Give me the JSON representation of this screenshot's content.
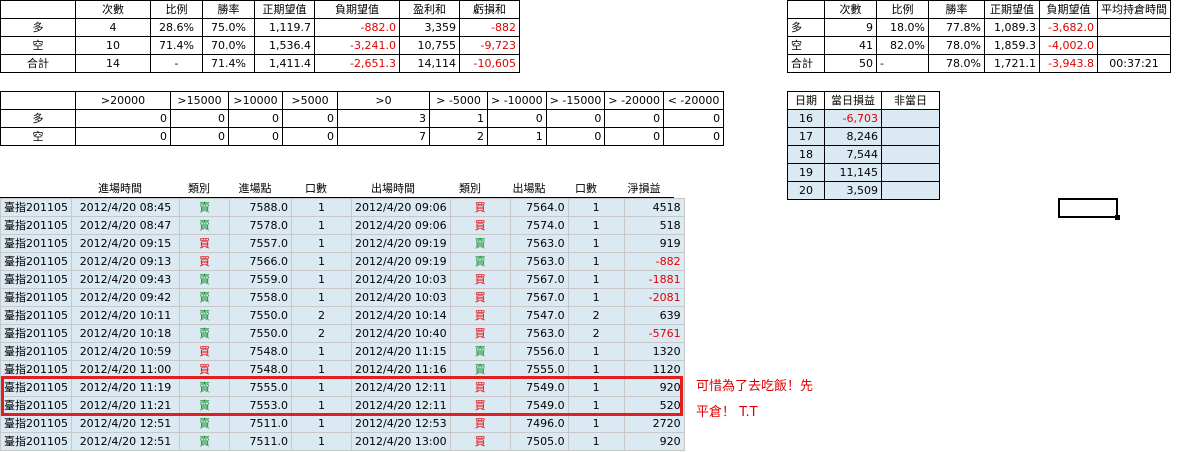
{
  "summary_left": {
    "headers": [
      "",
      "次數",
      "比例",
      "勝率",
      "正期望值",
      "負期望值",
      "盈利和",
      "虧損和"
    ],
    "rows": [
      {
        "label": "多",
        "count": "4",
        "ratio": "28.6%",
        "winrate": "75.0%",
        "pos_ev": "1,119.7",
        "neg_ev": "-882.0",
        "profit": "3,359",
        "loss": "-882"
      },
      {
        "label": "空",
        "count": "10",
        "ratio": "71.4%",
        "winrate": "70.0%",
        "pos_ev": "1,536.4",
        "neg_ev": "-3,241.0",
        "profit": "10,755",
        "loss": "-9,723"
      },
      {
        "label": "合計",
        "count": "14",
        "ratio": "-",
        "winrate": "71.4%",
        "pos_ev": "1,411.4",
        "neg_ev": "-2,651.3",
        "profit": "14,114",
        "loss": "-10,605"
      }
    ]
  },
  "summary_right": {
    "headers": [
      "",
      "次數",
      "比例",
      "勝率",
      "正期望值",
      "負期望值",
      "平均持倉時間"
    ],
    "rows": [
      {
        "label": "多",
        "count": "9",
        "ratio": "18.0%",
        "winrate": "77.8%",
        "pos_ev": "1,089.3",
        "neg_ev": "-3,682.0",
        "avg_time": ""
      },
      {
        "label": "空",
        "count": "41",
        "ratio": "82.0%",
        "winrate": "78.0%",
        "pos_ev": "1,859.3",
        "neg_ev": "-4,002.0",
        "avg_time": ""
      },
      {
        "label": "合計",
        "count": "50",
        "ratio": "-",
        "winrate": "78.0%",
        "pos_ev": "1,721.1",
        "neg_ev": "-3,943.8",
        "avg_time": "00:37:21"
      }
    ]
  },
  "distribution": {
    "headers": [
      ">20000",
      ">15000",
      ">10000",
      ">5000",
      ">0",
      "> -5000",
      "> -10000",
      "> -15000",
      "> -20000",
      "< -20000"
    ],
    "rows": [
      {
        "label": "多",
        "values": [
          "0",
          "0",
          "0",
          "0",
          "3",
          "1",
          "0",
          "0",
          "0",
          "0"
        ]
      },
      {
        "label": "空",
        "values": [
          "0",
          "0",
          "0",
          "0",
          "7",
          "2",
          "1",
          "0",
          "0",
          "0"
        ]
      }
    ]
  },
  "daily": {
    "headers": [
      "日期",
      "當日損益",
      "非當日"
    ],
    "rows": [
      {
        "day": "16",
        "pnl": "-6,703",
        "other": ""
      },
      {
        "day": "17",
        "pnl": "8,246",
        "other": ""
      },
      {
        "day": "18",
        "pnl": "7,544",
        "other": ""
      },
      {
        "day": "19",
        "pnl": "11,145",
        "other": ""
      },
      {
        "day": "20",
        "pnl": "3,509",
        "other": ""
      }
    ]
  },
  "trades": {
    "headers": [
      "",
      "進場時間",
      "類別",
      "進場點",
      "口數",
      "出場時間",
      "類別",
      "出場點",
      "口數",
      "淨損益"
    ],
    "rows": [
      {
        "symbol": "臺指201105",
        "entry_time": "2012/4/20 08:45",
        "entry_type": "賣",
        "entry_price": "7588.0",
        "entry_qty": "1",
        "exit_time": "2012/4/20 09:06",
        "exit_type": "買",
        "exit_price": "7564.0",
        "exit_qty": "1",
        "pnl": "4518"
      },
      {
        "symbol": "臺指201105",
        "entry_time": "2012/4/20 08:47",
        "entry_type": "賣",
        "entry_price": "7578.0",
        "entry_qty": "1",
        "exit_time": "2012/4/20 09:06",
        "exit_type": "買",
        "exit_price": "7574.0",
        "exit_qty": "1",
        "pnl": "518"
      },
      {
        "symbol": "臺指201105",
        "entry_time": "2012/4/20 09:15",
        "entry_type": "買",
        "entry_price": "7557.0",
        "entry_qty": "1",
        "exit_time": "2012/4/20 09:19",
        "exit_type": "賣",
        "exit_price": "7563.0",
        "exit_qty": "1",
        "pnl": "919"
      },
      {
        "symbol": "臺指201105",
        "entry_time": "2012/4/20 09:13",
        "entry_type": "買",
        "entry_price": "7566.0",
        "entry_qty": "1",
        "exit_time": "2012/4/20 09:19",
        "exit_type": "賣",
        "exit_price": "7563.0",
        "exit_qty": "1",
        "pnl": "-882"
      },
      {
        "symbol": "臺指201105",
        "entry_time": "2012/4/20 09:43",
        "entry_type": "賣",
        "entry_price": "7559.0",
        "entry_qty": "1",
        "exit_time": "2012/4/20 10:03",
        "exit_type": "買",
        "exit_price": "7567.0",
        "exit_qty": "1",
        "pnl": "-1881"
      },
      {
        "symbol": "臺指201105",
        "entry_time": "2012/4/20 09:42",
        "entry_type": "賣",
        "entry_price": "7558.0",
        "entry_qty": "1",
        "exit_time": "2012/4/20 10:03",
        "exit_type": "買",
        "exit_price": "7567.0",
        "exit_qty": "1",
        "pnl": "-2081"
      },
      {
        "symbol": "臺指201105",
        "entry_time": "2012/4/20 10:11",
        "entry_type": "賣",
        "entry_price": "7550.0",
        "entry_qty": "2",
        "exit_time": "2012/4/20 10:14",
        "exit_type": "買",
        "exit_price": "7547.0",
        "exit_qty": "2",
        "pnl": "639"
      },
      {
        "symbol": "臺指201105",
        "entry_time": "2012/4/20 10:18",
        "entry_type": "賣",
        "entry_price": "7550.0",
        "entry_qty": "2",
        "exit_time": "2012/4/20 10:40",
        "exit_type": "買",
        "exit_price": "7563.0",
        "exit_qty": "2",
        "pnl": "-5761"
      },
      {
        "symbol": "臺指201105",
        "entry_time": "2012/4/20 10:59",
        "entry_type": "買",
        "entry_price": "7548.0",
        "entry_qty": "1",
        "exit_time": "2012/4/20 11:15",
        "exit_type": "賣",
        "exit_price": "7556.0",
        "exit_qty": "1",
        "pnl": "1320"
      },
      {
        "symbol": "臺指201105",
        "entry_time": "2012/4/20 11:00",
        "entry_type": "買",
        "entry_price": "7548.0",
        "entry_qty": "1",
        "exit_time": "2012/4/20 11:16",
        "exit_type": "賣",
        "exit_price": "7555.0",
        "exit_qty": "1",
        "pnl": "1120"
      },
      {
        "symbol": "臺指201105",
        "entry_time": "2012/4/20 11:19",
        "entry_type": "賣",
        "entry_price": "7555.0",
        "entry_qty": "1",
        "exit_time": "2012/4/20 12:11",
        "exit_type": "買",
        "exit_price": "7549.0",
        "exit_qty": "1",
        "pnl": "920"
      },
      {
        "symbol": "臺指201105",
        "entry_time": "2012/4/20 11:21",
        "entry_type": "賣",
        "entry_price": "7553.0",
        "entry_qty": "1",
        "exit_time": "2012/4/20 12:11",
        "exit_type": "買",
        "exit_price": "7549.0",
        "exit_qty": "1",
        "pnl": "520"
      },
      {
        "symbol": "臺指201105",
        "entry_time": "2012/4/20 12:51",
        "entry_type": "賣",
        "entry_price": "7511.0",
        "entry_qty": "1",
        "exit_time": "2012/4/20 12:53",
        "exit_type": "買",
        "exit_price": "7496.0",
        "exit_qty": "1",
        "pnl": "2720"
      },
      {
        "symbol": "臺指201105",
        "entry_time": "2012/4/20 12:51",
        "entry_type": "賣",
        "entry_price": "7511.0",
        "entry_qty": "1",
        "exit_time": "2012/4/20 13:00",
        "exit_type": "買",
        "exit_price": "7505.0",
        "exit_qty": "1",
        "pnl": "920"
      }
    ]
  },
  "annotation": {
    "line1": "可惜為了去吃飯！先",
    "line2": "平倉！ T.T"
  },
  "colors": {
    "negative": "#e00000",
    "sell": "#138c2e",
    "buy": "#e00000",
    "row_fill": "#dbe9f3",
    "highlight_box": "#e02020"
  }
}
